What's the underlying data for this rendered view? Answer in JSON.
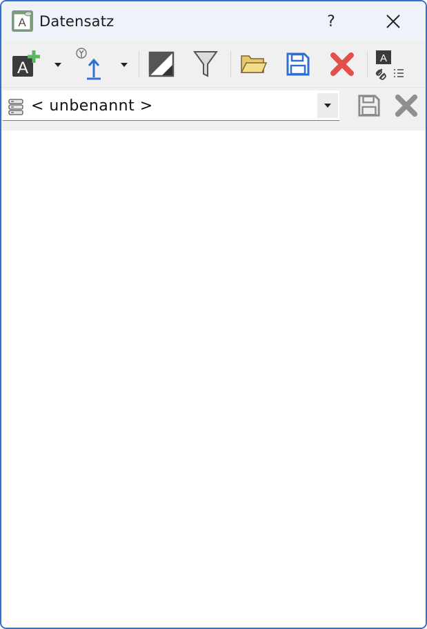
{
  "window": {
    "title": "Datensatz",
    "help_label": "?",
    "app_icon_letter": "A"
  },
  "toolbar": {
    "new_icon_letter": "A",
    "link_icon_letter": "A"
  },
  "record": {
    "selected": "< unbenannt >"
  },
  "colors": {
    "accent": "#2f6fd0",
    "add_green": "#5cb85c",
    "delete_red": "#e2504a",
    "save_blue": "#2f6fd0",
    "folder_yellow": "#e8c86a"
  }
}
